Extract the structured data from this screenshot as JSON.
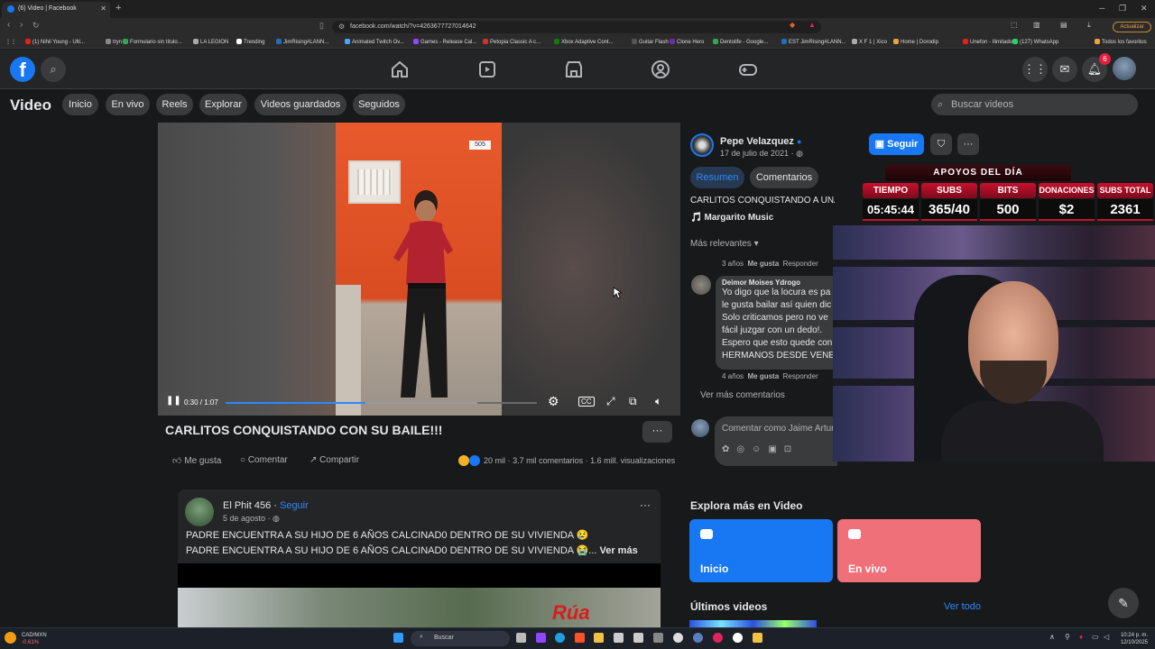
{
  "browser": {
    "tab_title": "(6) Video | Facebook",
    "url": "facebook.com/watch/?v=4263677727014642",
    "update_label": "Actualizar",
    "bookmarks": [
      {
        "label": "(1) Nihil Young - Ulti...",
        "color": "#e62117"
      },
      {
        "label": "tryn",
        "color": "#888888"
      },
      {
        "label": "Formulario sin título...",
        "color": "#34a853"
      },
      {
        "label": "LA LEGION",
        "color": "#aaaaaa"
      },
      {
        "label": "Trending",
        "color": "#ffffff"
      },
      {
        "label": "JimRising#LANN...",
        "color": "#1f6fbf"
      },
      {
        "label": "Animated Twitch Ov...",
        "color": "#4aa3ff"
      },
      {
        "label": "Games - Release Cal...",
        "color": "#9146ff"
      },
      {
        "label": "Petopia Classic A c...",
        "color": "#cc3333"
      },
      {
        "label": "Xbox Adaptive Cont...",
        "color": "#107c10"
      },
      {
        "label": "Guitar Flash",
        "color": "#555555"
      },
      {
        "label": "Clone Hero",
        "color": "#6c2ea8"
      },
      {
        "label": "Dentolife - Google...",
        "color": "#34a853"
      },
      {
        "label": "EST JimRising#LANN...",
        "color": "#1f6fbf"
      },
      {
        "label": "X F 1 | Xico",
        "color": "#aaaaaa"
      },
      {
        "label": "Home | Dorodip",
        "color": "#e8a33c"
      },
      {
        "label": "Unefon - Ilimitado",
        "color": "#e62117"
      },
      {
        "label": "(127) WhatsApp",
        "color": "#25d366"
      },
      {
        "label": "Todos los favoritos",
        "color": "#e8a33c"
      }
    ]
  },
  "topbar": {
    "notification_count": "6"
  },
  "video_nav": {
    "title": "Video",
    "pills": [
      "Inicio",
      "En vivo",
      "Reels",
      "Explorar",
      "Videos guardados",
      "Seguidos"
    ],
    "search_placeholder": "Buscar videos"
  },
  "player": {
    "time": "0:30 / 1:07",
    "progress": 0.45,
    "buffered": 0.81,
    "house_number": "505"
  },
  "video": {
    "title": "CARLITOS CONQUISTANDO CON SU BAILE!!!",
    "actions": [
      "Me gusta",
      "Comentar",
      "Compartir"
    ],
    "reactions_count": "20 mil",
    "comments_count": "3.7 mil comentarios",
    "views": "1.6 mill. visualizaciones"
  },
  "panel": {
    "author": "Pepe Velazquez",
    "date": "17 de julio de 2021",
    "follow_label": "Seguir",
    "tabs": [
      "Resumen",
      "Comentarios"
    ],
    "description": "CARLITOS CONQUISTANDO A UNA CHAVA",
    "music": "Margarito Music",
    "sort_label": "Más relevantes",
    "meta1": {
      "time": "3 años",
      "like": "Me gusta",
      "reply": "Responder"
    },
    "comment": {
      "author": "Deimor Moises Ydrogo",
      "lines": [
        "Yo digo que la locura es pa",
        "le gusta bailar así quien dic",
        "Solo criticamos pero no ve",
        "fácil juzgar con un dedo!.",
        "Espero que esto quede con",
        "HERMANOS DESDE VENEZ"
      ]
    },
    "meta2": {
      "time": "4 años",
      "like": "Me gusta",
      "reply": "Responder"
    },
    "more_comments": "Ver más comentarios",
    "comment_placeholder": "Comentar como Jaime Arturo"
  },
  "overlay": {
    "title": "APOYOS DEL DÍA",
    "headers": [
      "TIEMPO",
      "SUBS",
      "BITS",
      "DONACIONES",
      "SUBS TOTAL"
    ],
    "values": [
      "05:45:44",
      "365/40",
      "500",
      "$2",
      "2361"
    ]
  },
  "feed": {
    "post": {
      "author": "El Phit 456",
      "follow": "Seguir",
      "date": "5 de agosto",
      "line1": "PADRE ENCUENTRA A SU HIJO DE 6 AÑOS CALCINAD0 DENTRO DE SU VIVIENDA 😢",
      "line2": "PADRE ENCUENTRA A SU HIJO DE 6 AÑOS CALCINAD0 DENTRO DE SU VIVIENDA 😭...",
      "see_more": "Ver más",
      "media_text": "Rúa"
    },
    "explore_title": "Explora más en Video",
    "cards": [
      "Inicio",
      "En vivo"
    ],
    "latest_title": "Últimos videos",
    "see_all": "Ver todo"
  },
  "taskbar": {
    "currency": "CAD/MXN",
    "currency_change": "-0.61%",
    "search": "Buscar",
    "time": "10:24 p. m.",
    "date": "12/10/2025"
  }
}
